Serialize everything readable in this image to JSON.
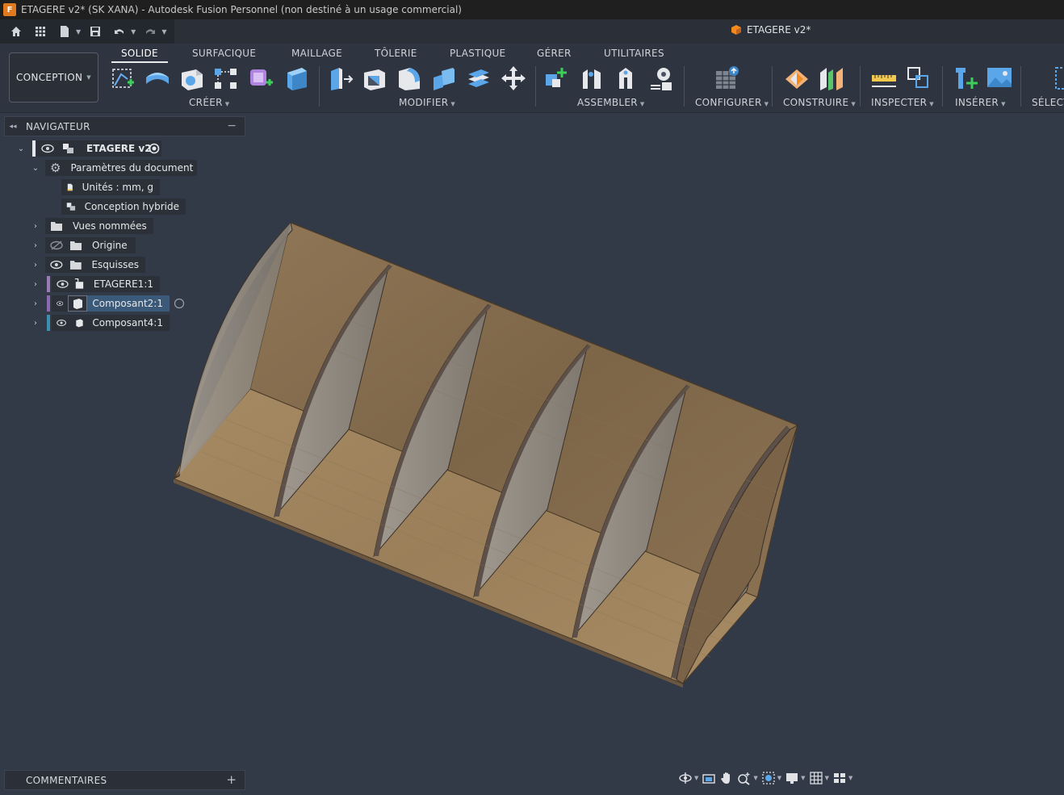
{
  "window": {
    "app_icon_letter": "F",
    "title": "ETAGERE v2* (SK XANA) - Autodesk Fusion Personnel (non destiné à un usage commercial)"
  },
  "document_tab": {
    "label": "ETAGERE v2*",
    "icon": "component-box-icon",
    "icon_color": "#f28a1e"
  },
  "workspace": {
    "label": "CONCEPTION"
  },
  "ribbon_tabs": [
    {
      "label": "SOLIDE",
      "active": true
    },
    {
      "label": "SURFACIQUE"
    },
    {
      "label": "MAILLAGE"
    },
    {
      "label": "TÔLERIE"
    },
    {
      "label": "PLASTIQUE"
    },
    {
      "label": "GÉRER"
    },
    {
      "label": "UTILITAIRES"
    }
  ],
  "tool_groups": {
    "create": "CRÉER",
    "modify": "MODIFIER",
    "assemble": "ASSEMBLER",
    "configure": "CONFIGURER",
    "construct": "CONSTRUIRE",
    "inspect": "INSPECTER",
    "insert": "INSÉRER",
    "select": "SÉLECT"
  },
  "navigator": {
    "title": "NAVIGATEUR",
    "root": {
      "label": "ETAGERE v2"
    },
    "items": [
      {
        "label": "Paramètres du document"
      },
      {
        "label": "Unités : mm, g"
      },
      {
        "label": "Conception hybride"
      },
      {
        "label": "Vues nommées"
      },
      {
        "label": "Origine"
      },
      {
        "label": "Esquisses"
      },
      {
        "label": "ETAGERE1:1",
        "color": "#9c7bb5"
      },
      {
        "label": "Composant2:1",
        "color": "#8b6bb0",
        "selected": true
      },
      {
        "label": "Composant4:1",
        "color": "#3d8fb0"
      }
    ]
  },
  "comments": {
    "title": "COMMENTAIRES"
  },
  "colors": {
    "accent_orange": "#f28a1e",
    "wood_light": "#a58a63",
    "wood_dark": "#6b5640",
    "panel_gray": "#8e867c",
    "viewport_bg": "#323a47"
  }
}
